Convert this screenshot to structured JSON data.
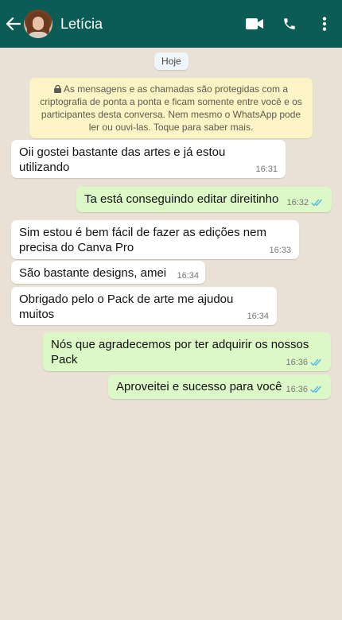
{
  "header": {
    "contact_name": "Letícia",
    "icons": [
      "arrow-left-icon",
      "avatar",
      "video-call-icon",
      "phone-icon",
      "more-vert-icon"
    ]
  },
  "chat": {
    "date_label": "Hoje",
    "encryption_notice": "As mensagens e as chamadas são protegidas com a criptografia de ponta a ponta e ficam somente entre você e os participantes desta conversa. Nem mesmo o WhatsApp pode ler ou ouvi-las. Toque para saber mais.",
    "messages": [
      {
        "direction": "incoming",
        "text": "Oii gostei bastante das artes e já estou utilizando",
        "time": "16:31"
      },
      {
        "direction": "outgoing",
        "text": "Ta está conseguindo editar direitinho",
        "time": "16:32",
        "status": "read"
      },
      {
        "direction": "incoming",
        "text": "Sim estou é bem fácil de fazer as edições nem precisa do Canva Pro",
        "time": "16:33"
      },
      {
        "direction": "incoming",
        "text": "São bastante designs, amei",
        "time": "16:34"
      },
      {
        "direction": "incoming",
        "text": "Obrigado pelo o Pack de arte me ajudou muitos",
        "time": "16:34"
      },
      {
        "direction": "outgoing",
        "text": "Nós que agradecemos por ter adquirir os nossos Pack",
        "time": "16:36",
        "status": "read"
      },
      {
        "direction": "outgoing",
        "text": "Aproveitei e sucesso para você",
        "time": "16:36",
        "status": "read"
      }
    ]
  },
  "colors": {
    "header": "#0b5c54",
    "incoming_bubble": "#ffffff",
    "outgoing_bubble": "#dcf8c6",
    "read_ticks": "#4fb6ec",
    "wallpaper": "#e9e1d6"
  }
}
